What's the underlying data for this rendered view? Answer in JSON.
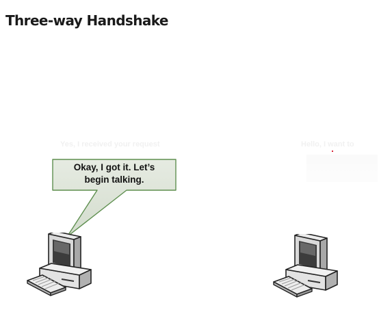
{
  "slide": {
    "title": "Three-way Handshake"
  },
  "callout": {
    "line1": "Okay, I got it. Let’s",
    "line2": "begin talking."
  },
  "faded_labels": {
    "left": "Yes, I received your request",
    "right": "Hello, I want to"
  },
  "colors": {
    "callout_fill": "#dbe3d6",
    "callout_border": "#5e8f4f",
    "title": "#1a1a1a"
  },
  "icons": {
    "left_host": "desktop-computer-icon",
    "right_host": "desktop-computer-icon"
  }
}
